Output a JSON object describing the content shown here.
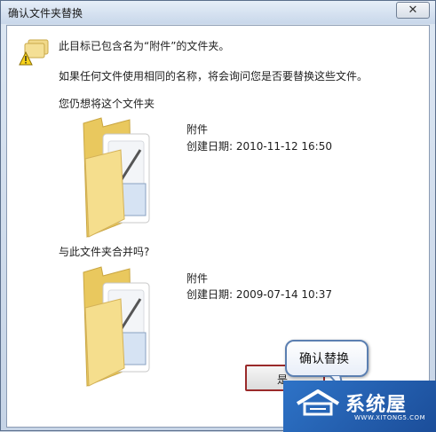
{
  "window": {
    "title": "确认文件夹替换",
    "close_symbol": "✕"
  },
  "dialog": {
    "message": "此目标已包含名为“附件”的文件夹。",
    "explanation": "如果任何文件使用相同的名称，将会询问您是否要替换这些文件。",
    "prompt_keep": "您仍想将这个文件夹",
    "prompt_merge": "与此文件夹合并吗?"
  },
  "source_folder": {
    "name": "附件",
    "created": "创建日期: 2010-11-12 16:50"
  },
  "target_folder": {
    "name": "附件",
    "created": "创建日期: 2009-07-14 10:37"
  },
  "buttons": {
    "yes_label": "是"
  },
  "callout": {
    "text": "确认替换"
  },
  "watermark": {
    "title": "系统屋",
    "url": "WWW.XITONG5.COM"
  },
  "colors": {
    "folder_yellow": "#f2d97c",
    "button_highlight": "#9a2a2a",
    "watermark_blue": "#2e73c7"
  }
}
